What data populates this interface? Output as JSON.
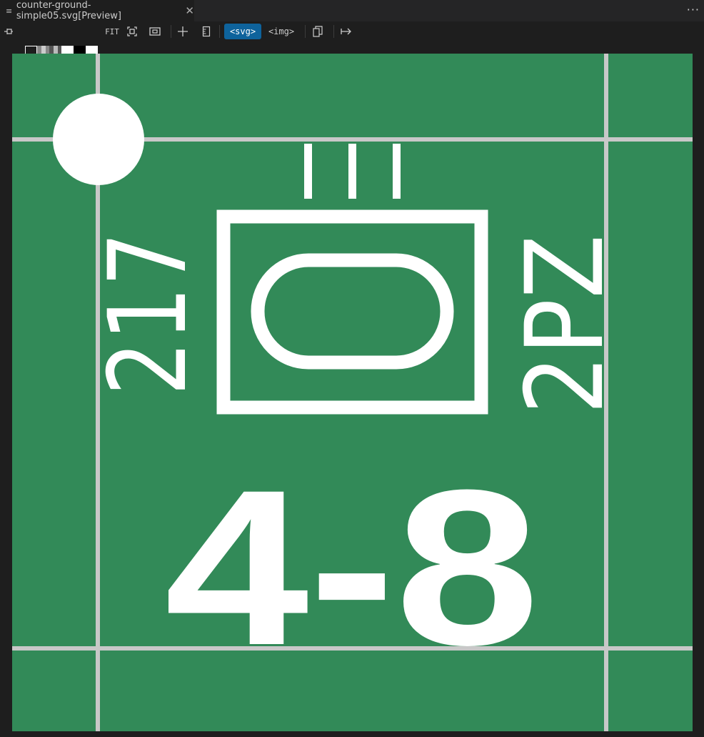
{
  "tab": {
    "title": "counter-ground-simple05.svg[Preview]",
    "close_glyph": "✕",
    "file_icon": "file-icon"
  },
  "toolbar": {
    "fit_label": "FIT",
    "svg_label": "<svg>",
    "img_label": "<img>",
    "more_label": "···"
  },
  "counter": {
    "left_text": "217",
    "right_text": "2PZ",
    "value_text": "4-8",
    "colors": {
      "ground": "#328a58",
      "lines": "#c8c8c8",
      "fg": "#ffffff"
    }
  }
}
